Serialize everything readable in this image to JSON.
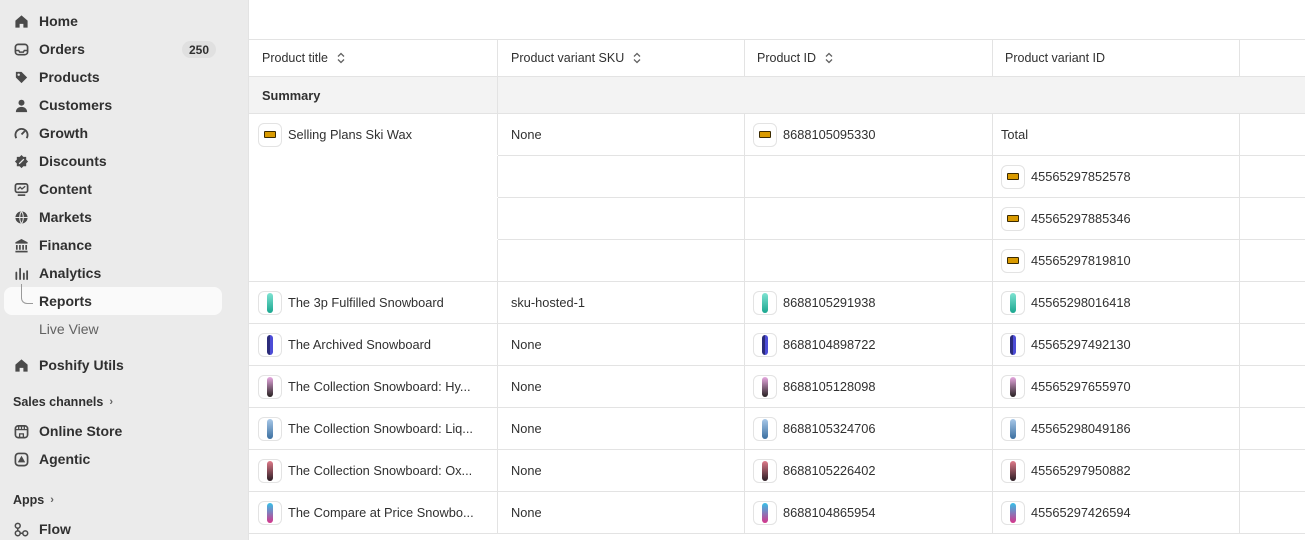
{
  "sidebar": {
    "items": [
      {
        "label": "Home",
        "icon": "home-icon"
      },
      {
        "label": "Orders",
        "icon": "inbox-icon",
        "badge": "250"
      },
      {
        "label": "Products",
        "icon": "tag-icon"
      },
      {
        "label": "Customers",
        "icon": "person-icon"
      },
      {
        "label": "Growth",
        "icon": "growth-icon"
      },
      {
        "label": "Discounts",
        "icon": "discount-icon"
      },
      {
        "label": "Content",
        "icon": "content-icon"
      },
      {
        "label": "Markets",
        "icon": "globe-icon"
      },
      {
        "label": "Finance",
        "icon": "bank-icon"
      },
      {
        "label": "Analytics",
        "icon": "bar-chart-icon"
      }
    ],
    "sub_items": [
      {
        "label": "Reports",
        "active": true
      },
      {
        "label": "Live View",
        "active": false
      }
    ],
    "app_item": {
      "label": "Poshify Utils",
      "icon": "home-icon"
    },
    "sales_channels": {
      "title": "Sales channels",
      "items": [
        {
          "label": "Online Store",
          "icon": "store-icon"
        },
        {
          "label": "Agentic",
          "icon": "agentic-icon"
        }
      ]
    },
    "apps": {
      "title": "Apps",
      "items": [
        {
          "label": "Flow",
          "icon": "flow-icon"
        }
      ]
    }
  },
  "table": {
    "columns": [
      "Product title",
      "Product variant SKU",
      "Product ID",
      "Product variant ID"
    ],
    "summary_label": "Summary",
    "rows": [
      {
        "title": "Selling Plans Ski Wax",
        "sku": "None",
        "product_id": "8688105095330",
        "variant_id": "Total",
        "thumb": "wax"
      },
      {
        "title": "",
        "sku": "",
        "product_id": "",
        "variant_id": "45565297852578",
        "thumb": "wax"
      },
      {
        "title": "",
        "sku": "",
        "product_id": "",
        "variant_id": "45565297885346",
        "thumb": "wax"
      },
      {
        "title": "",
        "sku": "",
        "product_id": "",
        "variant_id": "45565297819810",
        "thumb": "wax"
      },
      {
        "title": "The 3p Fulfilled Snowboard",
        "sku": "sku-hosted-1",
        "product_id": "8688105291938",
        "variant_id": "45565298016418",
        "thumb": "teal"
      },
      {
        "title": "The Archived Snowboard",
        "sku": "None",
        "product_id": "8688104898722",
        "variant_id": "45565297492130",
        "thumb": "navy"
      },
      {
        "title": "The Collection Snowboard: Hy...",
        "sku": "None",
        "product_id": "8688105128098",
        "variant_id": "45565297655970",
        "thumb": "pink"
      },
      {
        "title": "The Collection Snowboard: Liq...",
        "sku": "None",
        "product_id": "8688105324706",
        "variant_id": "45565298049186",
        "thumb": "blue"
      },
      {
        "title": "The Collection Snowboard: Ox...",
        "sku": "None",
        "product_id": "8688105226402",
        "variant_id": "45565297950882",
        "thumb": "red"
      },
      {
        "title": "The Compare at Price Snowbo...",
        "sku": "None",
        "product_id": "8688104865954",
        "variant_id": "45565297426594",
        "thumb": "gradient"
      }
    ]
  },
  "colors": {
    "sidebar_bg": "#ebebeb",
    "active_bg": "#fafafa",
    "summary_bg": "#f3f3f3",
    "border": "#e3e3e3",
    "text": "#303030"
  }
}
